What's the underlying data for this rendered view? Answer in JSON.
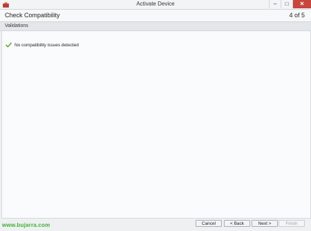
{
  "window": {
    "title": "Activate Device",
    "minimize_glyph": "‒",
    "maximize_glyph": "□",
    "close_glyph": "✕"
  },
  "header": {
    "title": "Check Compatibility",
    "step": "4 of 5"
  },
  "section": {
    "label": "Validations"
  },
  "status": {
    "message": "No compatibility issues detected",
    "icon": "check-icon"
  },
  "footer": {
    "watermark": "www.bujarra.com",
    "cancel_label": "Cancel",
    "back_label": "< Back",
    "next_label": "Next >",
    "finish_label": "Finish"
  },
  "colors": {
    "accent_close": "#c7463d",
    "check_green": "#5aa832",
    "watermark_green": "#3fb030"
  }
}
